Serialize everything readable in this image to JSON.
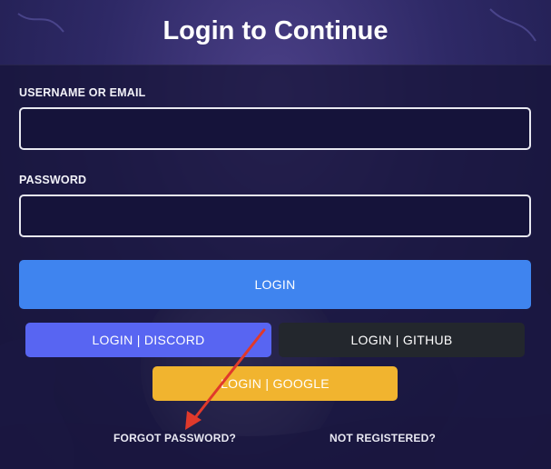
{
  "page": {
    "title": "Login to Continue"
  },
  "form": {
    "username_label": "USERNAME OR EMAIL",
    "username_value": "",
    "password_label": "PASSWORD",
    "password_value": "",
    "login_button": "LOGIN"
  },
  "oauth": {
    "discord_button": "LOGIN | DISCORD",
    "github_button": "LOGIN | GITHUB",
    "google_button": "LOGIN | GOOGLE"
  },
  "links": {
    "forgot_password": "FORGOT PASSWORD?",
    "not_registered": "NOT REGISTERED?"
  },
  "colors": {
    "login": "#3f84ef",
    "discord": "#5865f2",
    "github": "#23272d",
    "google": "#f1b42f",
    "annotation_arrow": "#e0392b"
  }
}
